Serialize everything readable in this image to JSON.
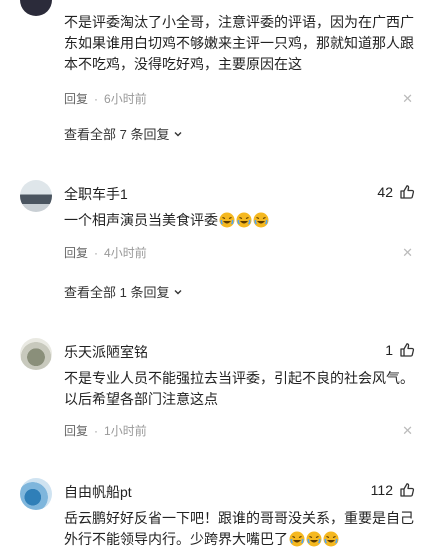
{
  "comments": [
    {
      "name": "",
      "likes": "",
      "text": "不是评委淘汰了小全哥，注意评委的评语，因为在广西广东如果谁用白切鸡不够嫩来主评一只鸡，那就知道那人跟本不吃鸡，没得吃好鸡，主要原因在这",
      "reply_label": "回复",
      "time": "6小时前",
      "more_label": "查看全部 7 条回复"
    },
    {
      "name": "全职车手1",
      "likes": "42",
      "text": "一个相声演员当美食评委",
      "emoji_count": 3,
      "reply_label": "回复",
      "time": "4小时前",
      "more_label": "查看全部 1 条回复"
    },
    {
      "name": "乐天派陋室铭",
      "likes": "1",
      "text": "不是专业人员不能强拉去当评委，引起不良的社会风气。以后希望各部门注意这点",
      "reply_label": "回复",
      "time": "1小时前"
    },
    {
      "name": "自由帆船pt",
      "likes": "112",
      "text": "岳云鹏好好反省一下吧！跟谁的哥哥没关系，重要是自己外行不能领导内行。少跨界大嘴巴了",
      "emoji_count": 3
    }
  ],
  "icons": {
    "like": "thumbs-up-icon",
    "close": "close-icon",
    "chevron": "chevron-down-icon",
    "emoji": "laughing-tears-emoji"
  },
  "colors": {
    "text": "#222222",
    "meta": "#666666",
    "muted": "#999999",
    "emoji": "#f5b820"
  }
}
